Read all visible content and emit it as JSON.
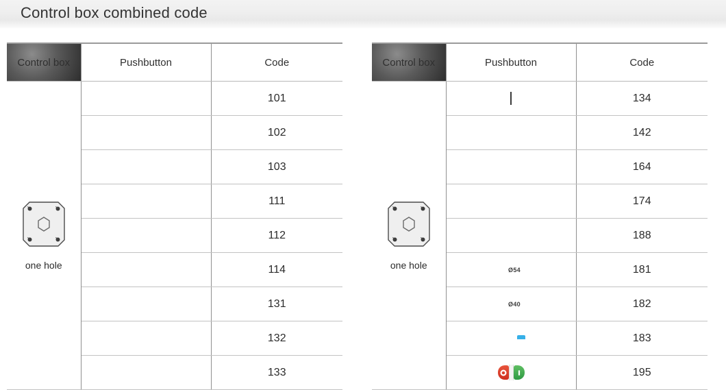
{
  "header": {
    "title": "Control box combined code"
  },
  "columns": {
    "control_box": "Control box",
    "pushbutton": "Pushbutton",
    "code": "Code"
  },
  "tables": [
    {
      "control_box": {
        "label": "one hole",
        "icon": "control-box-one-hole-icon"
      },
      "rows": [
        {
          "icon": "green-round-pushbutton-icon",
          "marking": "",
          "code": "101"
        },
        {
          "icon": "green-round-arrow-pushbutton-icon",
          "marking": "",
          "code": "102"
        },
        {
          "icon": "green-round-double-arrow-pushbutton-icon",
          "marking": "",
          "code": "103"
        },
        {
          "icon": "red-round-pushbutton-icon",
          "marking": "",
          "code": "111"
        },
        {
          "icon": "red-round-ring-pushbutton-icon",
          "marking": "",
          "code": "112"
        },
        {
          "icon": "red-round-stop-pushbutton-icon",
          "marking": "",
          "code": "114"
        },
        {
          "icon": "yellow-round-pushbutton-icon",
          "marking": "",
          "code": "131"
        },
        {
          "icon": "black-selector-knob-icon",
          "marking": "",
          "code": "132"
        },
        {
          "icon": "orange-round-pushbutton-icon",
          "marking": "",
          "code": "133"
        }
      ]
    },
    {
      "control_box": {
        "label": "one hole",
        "icon": "control-box-one-hole-icon"
      },
      "rows": [
        {
          "icon": "black-square-selector-switch-icon",
          "marking": "",
          "code": "134"
        },
        {
          "icon": "black-key-switch-icon",
          "marking": "",
          "code": "142"
        },
        {
          "icon": "red-mushroom-emergency-stop-icon",
          "marking": "",
          "code": "164"
        },
        {
          "icon": "red-mushroom-twist-release-icon",
          "marking": "",
          "code": "174"
        },
        {
          "icon": "red-key-release-emergency-stop-icon",
          "marking": "",
          "code": "188"
        },
        {
          "icon": "red-mushroom-emergency-stop-icon",
          "marking": "Ø54",
          "code": "181"
        },
        {
          "icon": "red-mushroom-emergency-stop-icon",
          "marking": "Ø40",
          "code": "182"
        },
        {
          "icon": "blue-square-pushbutton-icon",
          "marking": "",
          "code": "183"
        },
        {
          "icon": "red-green-dual-pushbutton-icon",
          "marking": "",
          "code": "195"
        }
      ]
    }
  ],
  "colors": {
    "title_text": "#333333",
    "green": "#27a35f",
    "red": "#ec5436",
    "yellow": "#e3e35a",
    "orange": "#f2a23c",
    "blue": "#12a0e8",
    "black": "#1c1c1c",
    "rule": "#c2c2c2"
  }
}
